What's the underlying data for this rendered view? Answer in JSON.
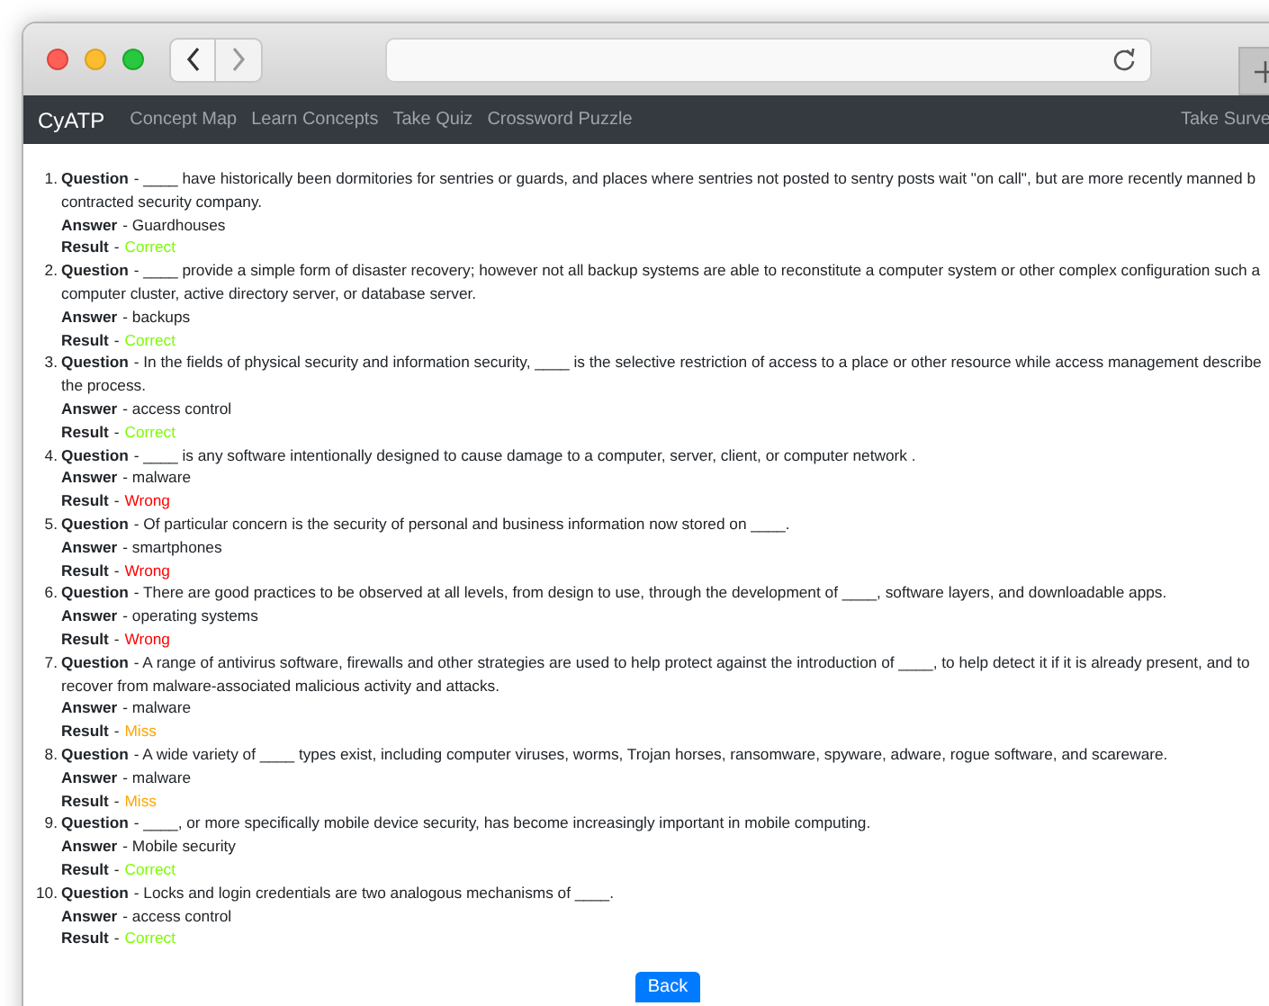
{
  "nav": {
    "brand": "CyATP",
    "links": [
      "Concept Map",
      "Learn Concepts",
      "Take Quiz",
      "Crossword Puzzle"
    ],
    "right_link": "Take Surve"
  },
  "results": [
    {
      "number": "1.",
      "question_label": "Question",
      "question_lines": [
        "- ____ have historically been dormitories for sentries or guards, and places where sentries not posted to sentry posts wait \"on call\", but are more recently manned b",
        "contracted security company."
      ],
      "answer_label": "Answer",
      "answer": "- Guardhouses",
      "result_label": "Result",
      "result_separator": "-",
      "result": "Correct",
      "color": "#7cfc00"
    },
    {
      "number": "2.",
      "question_label": "Question",
      "question_lines": [
        "- ____ provide a simple form of disaster recovery; however not all backup systems are able to reconstitute a computer system or other complex configuration such a",
        "computer cluster, active directory server, or database server."
      ],
      "answer_label": "Answer",
      "answer": "- backups",
      "result_label": "Result",
      "result_separator": "-",
      "result": "Correct",
      "color": "#7cfc00"
    },
    {
      "number": "3.",
      "question_label": "Question",
      "question_lines": [
        "- In the fields of physical security and information security, ____ is the selective restriction of access to a place or other resource while access management describe",
        "the process."
      ],
      "answer_label": "Answer",
      "answer": "- access control",
      "result_label": "Result",
      "result_separator": "-",
      "result": "Correct",
      "color": "#7cfc00"
    },
    {
      "number": "4.",
      "question_label": "Question",
      "question_lines": [
        "- ____ is any software intentionally designed to cause damage to a computer, server, client, or computer network ."
      ],
      "answer_label": "Answer",
      "answer": "- malware",
      "result_label": "Result",
      "result_separator": "-",
      "result": "Wrong",
      "color": "#ff0000"
    },
    {
      "number": "5.",
      "question_label": "Question",
      "question_lines": [
        "- Of particular concern is the security of personal and business information now stored on ____."
      ],
      "answer_label": "Answer",
      "answer": "- smartphones",
      "result_label": "Result",
      "result_separator": "-",
      "result": "Wrong",
      "color": "#ff0000"
    },
    {
      "number": "6.",
      "question_label": "Question",
      "question_lines": [
        "- There are good practices to be observed at all levels, from design to use, through the development of ____, software layers, and downloadable apps."
      ],
      "answer_label": "Answer",
      "answer": "- operating systems",
      "result_label": "Result",
      "result_separator": "-",
      "result": "Wrong",
      "color": "#ff0000"
    },
    {
      "number": "7.",
      "question_label": "Question",
      "question_lines": [
        "- A range of antivirus software, firewalls and other strategies are used to help protect against the introduction of ____, to help detect it if it is already present, and to",
        "recover from malware-associated malicious activity and attacks."
      ],
      "answer_label": "Answer",
      "answer": "- malware",
      "result_label": "Result",
      "result_separator": "-",
      "result": "Miss",
      "color": "#ffa500"
    },
    {
      "number": "8.",
      "question_label": "Question",
      "question_lines": [
        "- A wide variety of ____ types exist, including computer viruses, worms, Trojan horses, ransomware, spyware, adware, rogue software, and scareware."
      ],
      "answer_label": "Answer",
      "answer": "- malware",
      "result_label": "Result",
      "result_separator": "-",
      "result": "Miss",
      "color": "#ffa500"
    },
    {
      "number": "9.",
      "question_label": "Question",
      "question_lines": [
        "- ____, or more specifically mobile device security, has become increasingly important in mobile computing."
      ],
      "answer_label": "Answer",
      "answer": "- Mobile security",
      "result_label": "Result",
      "result_separator": "-",
      "result": "Correct",
      "color": "#7cfc00"
    },
    {
      "number": "10.",
      "question_label": "Question",
      "question_lines": [
        "- Locks and login credentials are two analogous mechanisms of ____."
      ],
      "answer_label": "Answer",
      "answer": "- access control",
      "result_label": "Result",
      "result_separator": "-",
      "result": "Correct",
      "color": "#7cfc00"
    }
  ],
  "back_button": "Back"
}
